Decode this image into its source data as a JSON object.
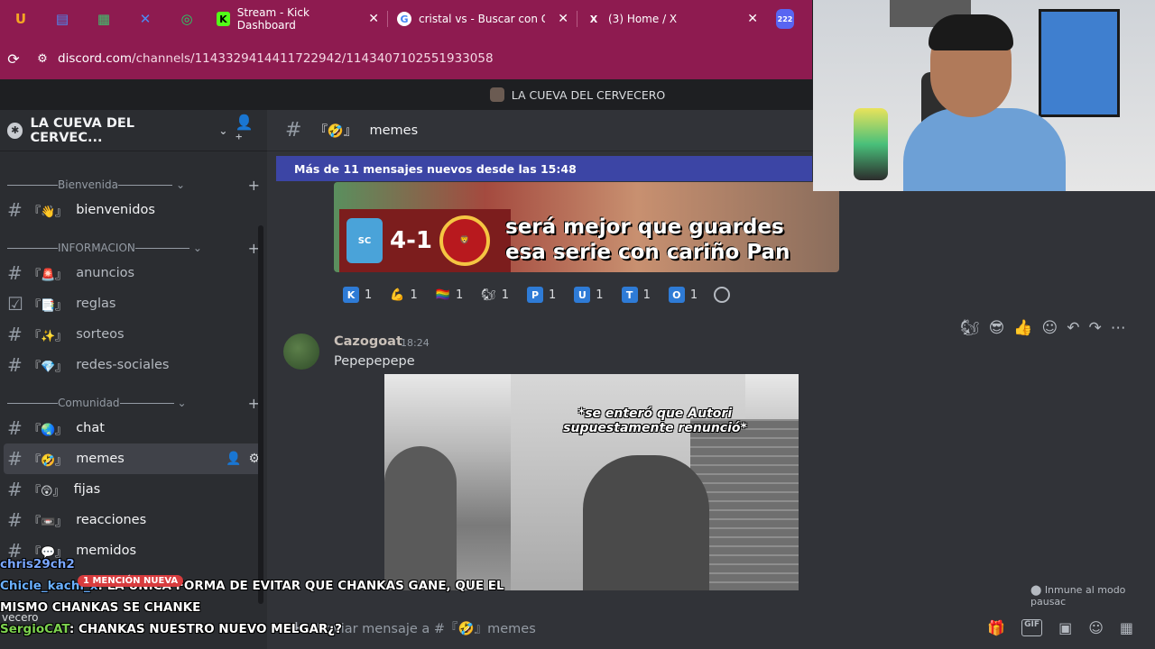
{
  "browser": {
    "tabs": [
      {
        "label": "Stream - Kick Dashboard",
        "fav": "K"
      },
      {
        "label": "cristal vs - Buscar con Go",
        "fav": "G"
      },
      {
        "label": "(3) Home / X",
        "fav": "X"
      }
    ],
    "tab_badge": "222",
    "url_host": "discord.com",
    "url_path": "/channels/1143329414411722942/1143407102551933058"
  },
  "server": {
    "strip_title": "LA CUEVA DEL CERVECERO",
    "name": "LA CUEVA DEL CERVEC..."
  },
  "sidebar": {
    "categories": [
      {
        "label": "Bienvenida",
        "channels": [
          {
            "emoji": "『👋』",
            "name": "bienvenidos"
          }
        ]
      },
      {
        "label": "INFORMACION",
        "channels": [
          {
            "emoji": "『🚨』",
            "name": "anuncios"
          },
          {
            "emoji": "『📑』",
            "name": "reglas"
          },
          {
            "emoji": "『✨』",
            "name": "sorteos"
          },
          {
            "emoji": "『💎』",
            "name": "redes-sociales"
          }
        ]
      },
      {
        "label": "Comunidad",
        "channels": [
          {
            "emoji": "『🌏』",
            "name": "chat"
          },
          {
            "emoji": "『🤣』",
            "name": "memes"
          },
          {
            "emoji": "『😲』",
            "name": "fijas"
          },
          {
            "emoji": "『📼』",
            "name": "reacciones"
          },
          {
            "emoji": "『💬』",
            "name": "memidos"
          }
        ]
      }
    ]
  },
  "channel": {
    "name": "memes",
    "emoji": "『🤣』",
    "new_messages_bar": "Más de 11 mensajes nuevos desde las 15:48"
  },
  "meme": {
    "score": "4-1",
    "caption_line1": "será mejor que guardes",
    "caption_line2": "esa serie con cariño Pan"
  },
  "reactions": [
    {
      "icon": "K",
      "color": "#2e7bd6",
      "count": "1"
    },
    {
      "icon": "💪",
      "color": "transparent",
      "count": "1"
    },
    {
      "icon": "🏳️‍🌈",
      "color": "transparent",
      "count": "1"
    },
    {
      "icon": "🐿",
      "color": "transparent",
      "count": "1"
    },
    {
      "icon": "P",
      "color": "#2e7bd6",
      "count": "1"
    },
    {
      "icon": "U",
      "color": "#2e7bd6",
      "count": "1"
    },
    {
      "icon": "T",
      "color": "#2e7bd6",
      "count": "1"
    },
    {
      "icon": "O",
      "color": "#2e7bd6",
      "count": "1"
    }
  ],
  "message": {
    "author": "Cazogoat",
    "time": "18:24",
    "text": "Pepepepepe",
    "video_caption": "*se enteró que Autori supuestamente renunció*"
  },
  "composer": {
    "placeholder": "Enviar mensaje a #『🤣』memes"
  },
  "immune_text": "Inmune al modo pausac",
  "stream_chat": [
    {
      "user": "chris29ch2",
      "text": ""
    },
    {
      "user": "Chicle_kachi_x",
      "text": ": LA ÚNICA FORMA DE EVITAR QUE CHANKAS GANE, QUE EL MISMO CHANKAS SE CHANKE"
    },
    {
      "user": "SergioCAT",
      "text": ": CHANKAS NUESTRO NUEVO MELGAR¿?"
    }
  ],
  "mention_badge": "1 MENCIÓN NUEVA",
  "user_fragment": "vecero"
}
